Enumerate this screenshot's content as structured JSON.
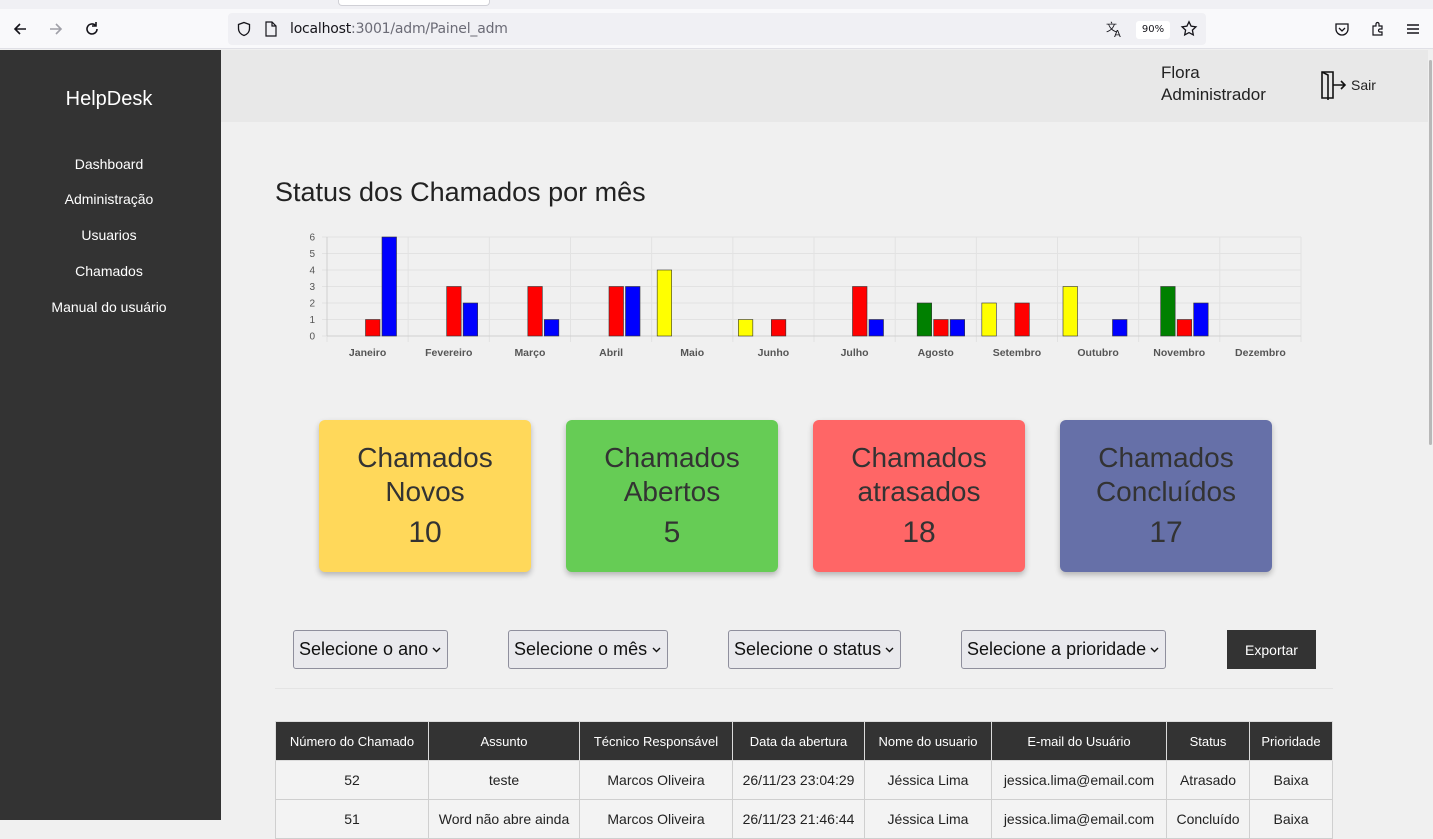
{
  "browser": {
    "url_host": "localhost",
    "url_path": ":3001/adm/Painel_adm",
    "zoom": "90%"
  },
  "sidebar": {
    "brand": "HelpDesk",
    "items": [
      {
        "label": "Dashboard"
      },
      {
        "label": "Administração"
      },
      {
        "label": "Usuarios"
      },
      {
        "label": "Chamados"
      },
      {
        "label": "Manual do usuário"
      }
    ]
  },
  "header": {
    "user_name": "Flora",
    "user_role": "Administrador",
    "logout_label": "Sair"
  },
  "chart_data": {
    "type": "bar",
    "title": "Status dos Chamados por mês",
    "categories": [
      "Janeiro",
      "Fevereiro",
      "Março",
      "Abril",
      "Maio",
      "Junho",
      "Julho",
      "Agosto",
      "Setembro",
      "Outubro",
      "Novembro",
      "Dezembro"
    ],
    "series": [
      {
        "color": "#ffff00",
        "values": [
          0,
          0,
          0,
          0,
          4,
          1,
          0,
          0,
          2,
          3,
          0,
          0
        ]
      },
      {
        "color": "#008000",
        "values": [
          0,
          0,
          0,
          0,
          0,
          0,
          0,
          2,
          0,
          0,
          3,
          0
        ]
      },
      {
        "color": "#ff0000",
        "values": [
          1,
          3,
          3,
          3,
          0,
          1,
          3,
          1,
          2,
          0,
          1,
          0
        ]
      },
      {
        "color": "#0000ff",
        "values": [
          6,
          2,
          1,
          3,
          0,
          0,
          1,
          1,
          0,
          1,
          2,
          0
        ]
      }
    ],
    "yticks": [
      "0",
      "1",
      "2",
      "3",
      "4",
      "5",
      "6"
    ],
    "ylim": [
      0,
      6
    ],
    "grid": true
  },
  "cards": [
    {
      "label": "Chamados Novos",
      "value": "10",
      "color": "#ffd85a"
    },
    {
      "label": "Chamados Abertos",
      "value": "5",
      "color": "#66cc55"
    },
    {
      "label": "Chamados atrasados",
      "value": "18",
      "color": "#ff6666"
    },
    {
      "label": "Chamados Concluídos",
      "value": "17",
      "color": "#6670a8"
    }
  ],
  "filters": {
    "year": "Selecione o ano",
    "month": "Selecione o mês",
    "status": "Selecione o status",
    "priority": "Selecione a prioridade",
    "export_label": "Exportar"
  },
  "table": {
    "columns": [
      "Número do Chamado",
      "Assunto",
      "Técnico Responsável",
      "Data da abertura",
      "Nome do usuario",
      "E-mail do Usuário",
      "Status",
      "Prioridade"
    ],
    "rows": [
      [
        "52",
        "teste",
        "Marcos Oliveira",
        "26/11/23 23:04:29",
        "Jéssica Lima",
        "jessica.lima@email.com",
        "Atrasado",
        "Baixa"
      ],
      [
        "51",
        "Word não abre ainda",
        "Marcos Oliveira",
        "26/11/23 21:46:44",
        "Jéssica Lima",
        "jessica.lima@email.com",
        "Concluído",
        "Baixa"
      ]
    ]
  }
}
